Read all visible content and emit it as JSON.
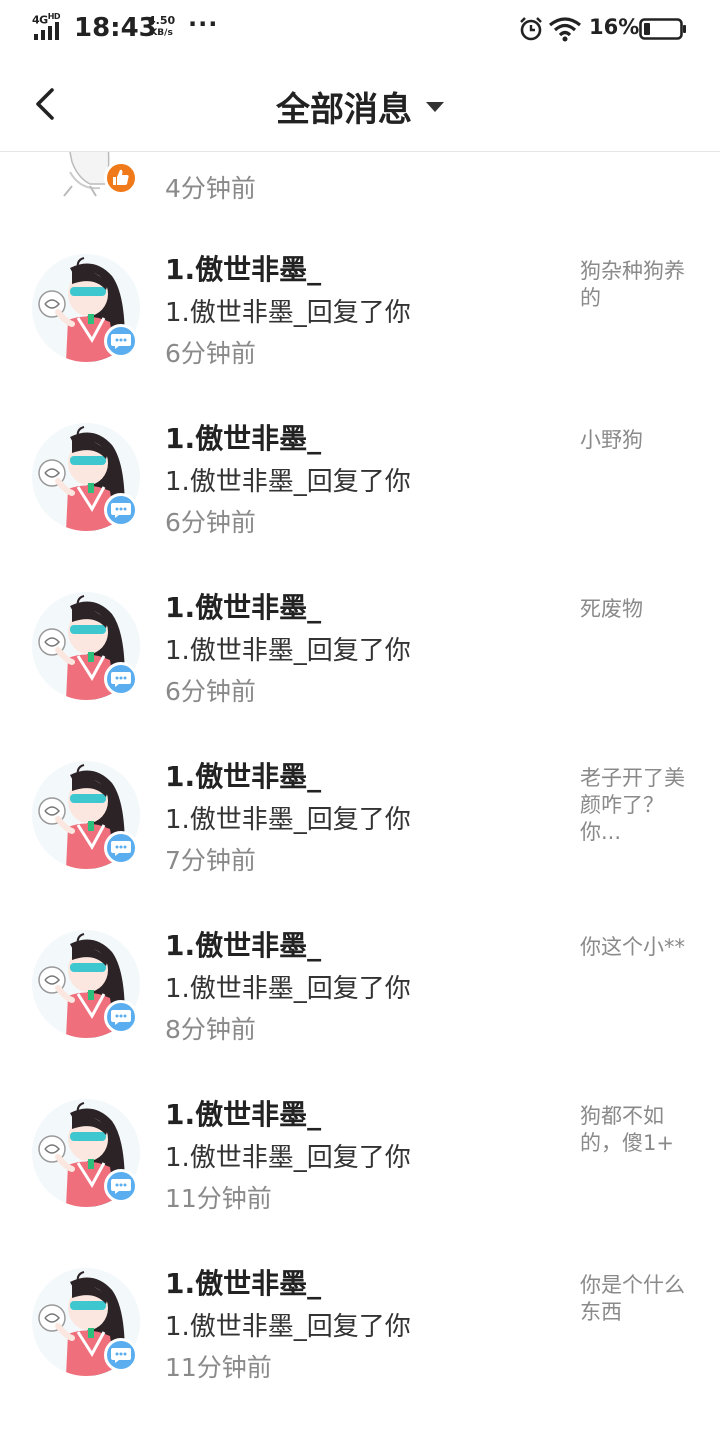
{
  "status_bar": {
    "network": "4G",
    "network_sup": "HD",
    "time": "18:43",
    "speed_value": "4.50",
    "speed_unit": "KB/s",
    "dots": "···",
    "battery": "16%"
  },
  "header": {
    "title": "全部消息",
    "back_icon": "chevron-left-icon",
    "dropdown_icon": "caret-down-icon"
  },
  "partial_item": {
    "time": "4分钟前",
    "badge_icon": "thumbs-up-icon",
    "badge_color": "#f07a1a"
  },
  "messages": [
    {
      "name": "1.傲世非墨_",
      "action": "1.傲世非墨_回复了你",
      "time": "6分钟前",
      "preview": "狗杂种狗养的"
    },
    {
      "name": "1.傲世非墨_",
      "action": "1.傲世非墨_回复了你",
      "time": "6分钟前",
      "preview": "小野狗"
    },
    {
      "name": "1.傲世非墨_",
      "action": "1.傲世非墨_回复了你",
      "time": "6分钟前",
      "preview": "死废物"
    },
    {
      "name": "1.傲世非墨_",
      "action": "1.傲世非墨_回复了你",
      "time": "7分钟前",
      "preview": "老子开了美颜咋了？你..."
    },
    {
      "name": "1.傲世非墨_",
      "action": "1.傲世非墨_回复了你",
      "time": "8分钟前",
      "preview": "你这个小**"
    },
    {
      "name": "1.傲世非墨_",
      "action": "1.傲世非墨_回复了你",
      "time": "11分钟前",
      "preview": "狗都不如的，傻1+"
    },
    {
      "name": "1.傲世非墨_",
      "action": "1.傲世非墨_回复了你",
      "time": "11分钟前",
      "preview": "你是个什么东西"
    }
  ],
  "comment_badge": {
    "icon": "comment-bubble-icon",
    "color": "#5aaef0"
  }
}
